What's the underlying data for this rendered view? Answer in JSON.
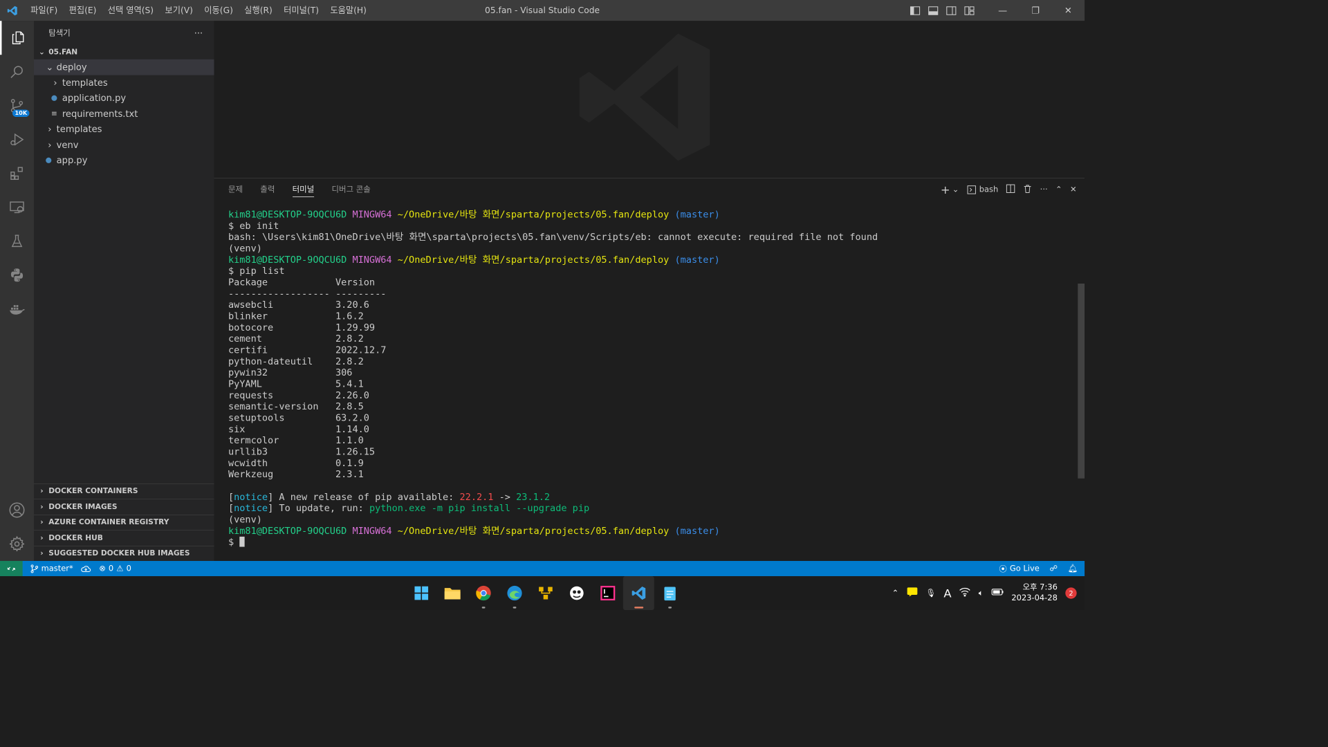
{
  "titlebar": {
    "title": "05.fan - Visual Studio Code",
    "menu": [
      "파일(F)",
      "편집(E)",
      "선택 영역(S)",
      "보기(V)",
      "이동(G)",
      "실행(R)",
      "터미널(T)",
      "도움말(H)"
    ]
  },
  "activity": {
    "scm_badge": "10K"
  },
  "sidebar": {
    "title": "탐색기",
    "more": "···",
    "root": "05.FAN",
    "tree": {
      "deploy": "deploy",
      "deploy_templates": "templates",
      "application": "application.py",
      "requirements": "requirements.txt",
      "templates": "templates",
      "venv": "venv",
      "app": "app.py"
    },
    "docker": [
      "DOCKER CONTAINERS",
      "DOCKER IMAGES",
      "AZURE CONTAINER REGISTRY",
      "DOCKER HUB",
      "SUGGESTED DOCKER HUB IMAGES"
    ]
  },
  "panel": {
    "tabs": [
      "문제",
      "출력",
      "터미널",
      "디버그 콘솔"
    ],
    "active_tab": "터미널",
    "shell": "bash"
  },
  "terminal": {
    "user_host": "kim81@DESKTOP-9OQCU6D",
    "env": "MINGW64",
    "path": "~/OneDrive/바탕 화면/sparta/projects/05.fan/deploy",
    "branch": "(master)",
    "cmd1": "$ eb init",
    "error": "bash: \\Users\\kim81\\OneDrive\\바탕 화면\\sparta\\projects\\05.fan\\venv/Scripts/eb: cannot execute: required file not found",
    "venv": "(venv)",
    "cmd2": "$ pip list",
    "header": "Package            Version",
    "divider": "------------------ ---------",
    "packages": [
      [
        "awsebcli",
        "3.20.6"
      ],
      [
        "blinker",
        "1.6.2"
      ],
      [
        "botocore",
        "1.29.99"
      ],
      [
        "cement",
        "2.8.2"
      ],
      [
        "certifi",
        "2022.12.7"
      ],
      [
        "python-dateutil",
        "2.8.2"
      ],
      [
        "pywin32",
        "306"
      ],
      [
        "PyYAML",
        "5.4.1"
      ],
      [
        "requests",
        "2.26.0"
      ],
      [
        "semantic-version",
        "2.8.5"
      ],
      [
        "setuptools",
        "63.2.0"
      ],
      [
        "six",
        "1.14.0"
      ],
      [
        "termcolor",
        "1.1.0"
      ],
      [
        "urllib3",
        "1.26.15"
      ],
      [
        "wcwidth",
        "0.1.9"
      ],
      [
        "Werkzeug",
        "2.3.1"
      ]
    ],
    "notice_word": "notice",
    "notice1_text": " A new release of pip available: ",
    "old_version": "22.2.1",
    "arrow": " -> ",
    "new_version": "23.1.2",
    "notice2_text": " To update, run: ",
    "update_cmd": "python.exe -m pip install --upgrade pip",
    "prompt": "$ "
  },
  "status": {
    "branch": "master*",
    "errors": "0",
    "warnings": "0",
    "go_live": "Go Live"
  },
  "taskbar": {
    "time": "오후 7:36",
    "date": "2023-04-28",
    "notifications": "2"
  },
  "colors": {
    "accent": "#007acc",
    "remote": "#16825d",
    "user": "#23d18b",
    "env": "#d670d6",
    "path": "#e5e510",
    "branch": "#3b8eea"
  }
}
